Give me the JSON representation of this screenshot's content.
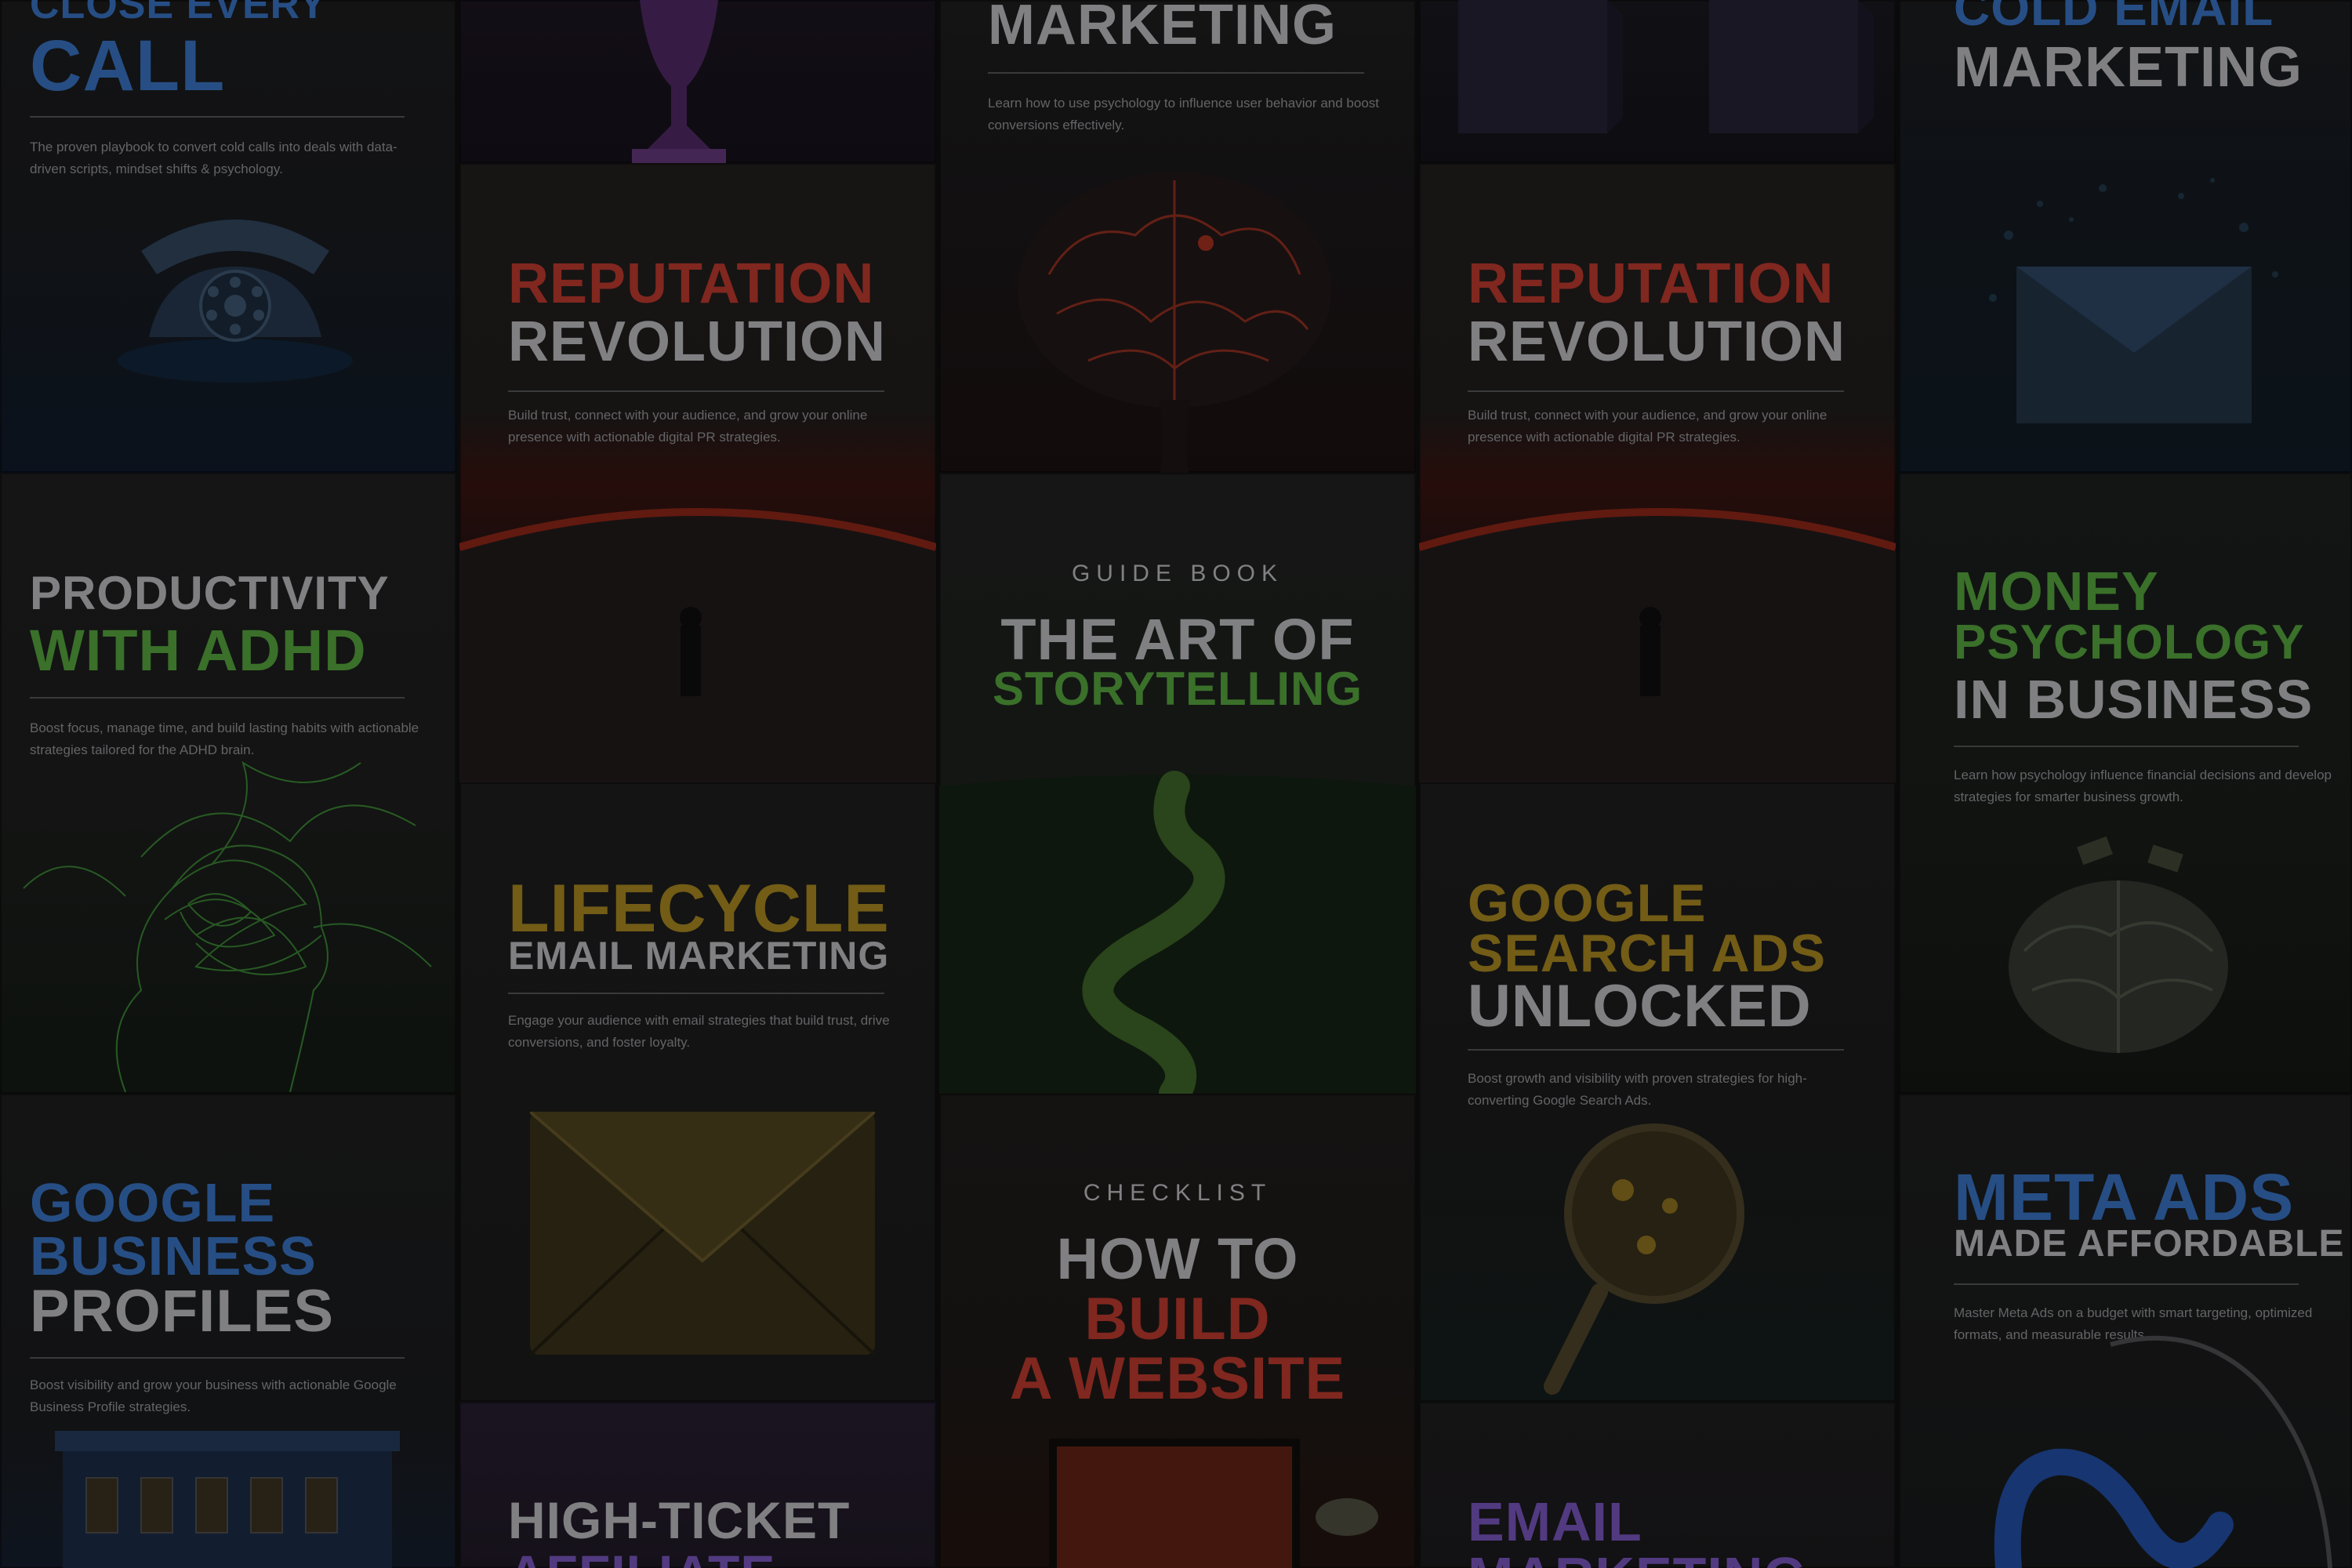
{
  "columns": [
    {
      "cards": [
        {
          "title_lines": [
            "CLOSE EVERY",
            "CALL"
          ],
          "description": "The proven playbook to convert cold calls into deals with data-driven scripts, mindset shifts & psychology.",
          "art_icon": "telephone-icon"
        },
        {
          "title_lines": [
            "PRODUCTIVITY",
            "WITH ADHD"
          ],
          "description": "Boost focus, manage time, and build lasting habits with actionable strategies tailored for the ADHD brain.",
          "art_icon": "neural-head-icon"
        },
        {
          "title_lines": [
            "GOOGLE",
            "BUSINESS",
            "PROFILES"
          ],
          "description": "Boost visibility and grow your business with actionable Google Business Profile strategies.",
          "art_icon": "storefront-icon"
        }
      ]
    },
    {
      "cards": [
        {
          "title_lines": [],
          "description": "",
          "art_icon": "trophy-icon"
        },
        {
          "title_lines": [
            "REPUTATION",
            "REVOLUTION"
          ],
          "description": "Build trust, connect with your audience, and grow your online presence with actionable digital PR strategies.",
          "art_icon": "planet-horizon-icon"
        },
        {
          "title_lines": [
            "LIFECYCLE",
            "EMAIL MARKETING"
          ],
          "description": "Engage your audience with email strategies that build trust, drive conversions, and foster loyalty.",
          "art_icon": "envelope-icon"
        },
        {
          "title_lines": [
            "HIGH-TICKET",
            "AFFILIATE"
          ],
          "description": "",
          "art_icon": ""
        }
      ]
    },
    {
      "cards": [
        {
          "title_lines": [
            "MARKETING"
          ],
          "description": "Learn how to use psychology to influence user behavior and boost conversions effectively.",
          "art_icon": "glowing-brain-icon"
        },
        {
          "kicker": "GUIDE BOOK",
          "title_lines": [
            "THE ART OF",
            "STORYTELLING"
          ],
          "description": "",
          "art_icon": "winding-road-icon"
        },
        {
          "kicker": "CHECKLIST",
          "title_lines": [
            "HOW TO",
            "BUILD",
            "A WEBSITE"
          ],
          "description": "",
          "art_icon": "monitor-desk-icon"
        }
      ]
    },
    {
      "cards": [
        {
          "title_lines": [],
          "description": "",
          "art_icon": "cubes-icon"
        },
        {
          "title_lines": [
            "REPUTATION",
            "REVOLUTION"
          ],
          "description": "Build trust, connect with your audience, and grow your online presence with actionable digital PR strategies.",
          "art_icon": "planet-horizon-icon"
        },
        {
          "title_lines": [
            "GOOGLE",
            "SEARCH ADS",
            "UNLOCKED"
          ],
          "description": "Boost growth and visibility with proven strategies for high-converting Google Search Ads.",
          "art_icon": "magnifying-glass-icon"
        },
        {
          "title_lines": [
            "EMAIL",
            "MARKETING"
          ],
          "description": "",
          "art_icon": ""
        }
      ]
    },
    {
      "cards": [
        {
          "title_lines": [
            "COLD EMAIL",
            "MARKETING"
          ],
          "description": "",
          "art_icon": "exploding-envelope-icon"
        },
        {
          "title_lines": [
            "MONEY",
            "PSYCHOLOGY",
            "IN BUSINESS"
          ],
          "description": "Learn how psychology influence financial decisions and develop strategies for smarter business growth.",
          "art_icon": "money-brain-icon"
        },
        {
          "title_lines": [
            "META ADS",
            "MADE AFFORDABLE"
          ],
          "description": "Master Meta Ads on a budget with smart targeting, optimized formats, and measurable results.",
          "art_icon": "meta-logo-icon"
        }
      ]
    }
  ]
}
